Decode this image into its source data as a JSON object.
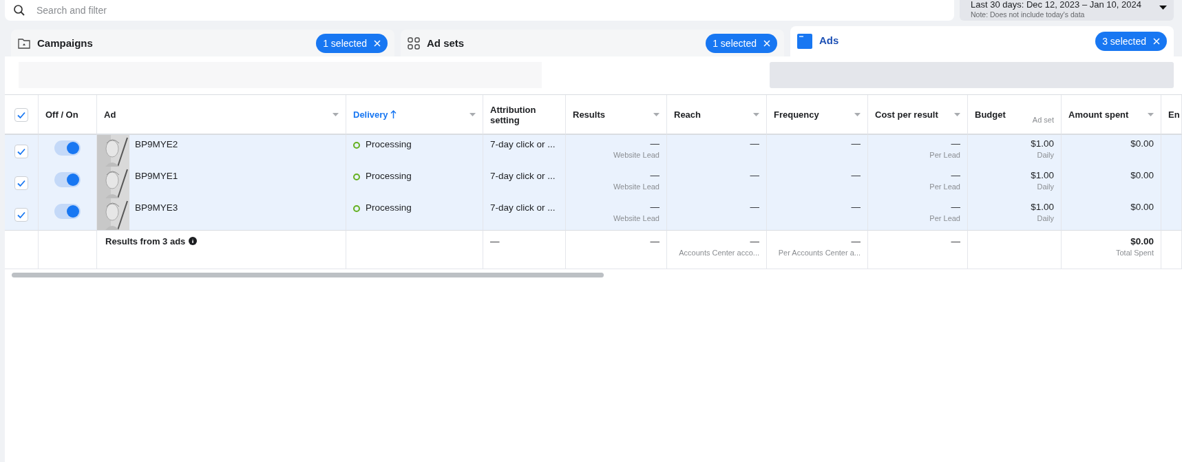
{
  "search": {
    "placeholder": "Search and filter"
  },
  "date_range": {
    "label": "Last 30 days: Dec 12, 2023 – Jan 10, 2024",
    "note": "Note: Does not include today's data"
  },
  "tabs": [
    {
      "kind": "folder",
      "label": "Campaigns",
      "badge": "1 selected",
      "selected": false
    },
    {
      "kind": "grid",
      "label": "Ad sets",
      "badge": "1 selected",
      "selected": false
    },
    {
      "kind": "ad",
      "label": "Ads",
      "badge": "3 selected",
      "selected": true
    }
  ],
  "table": {
    "all_selected": true,
    "columns": [
      {
        "label": "Off / On",
        "menu": false,
        "sorted": false
      },
      {
        "label": "Ad",
        "menu": true,
        "sorted": false
      },
      {
        "label": "Delivery",
        "menu": true,
        "sorted": true
      },
      {
        "label": "Attribution setting",
        "menu": false,
        "sorted": false
      },
      {
        "label": "Results",
        "menu": true,
        "sorted": false
      },
      {
        "label": "Reach",
        "menu": true,
        "sorted": false
      },
      {
        "label": "Frequency",
        "menu": true,
        "sorted": false
      },
      {
        "label": "Cost per result",
        "menu": true,
        "sorted": false
      },
      {
        "label": "Budget",
        "sublabel": "Ad set",
        "menu": false,
        "sorted": false
      },
      {
        "label": "Amount spent",
        "menu": true,
        "sorted": false
      },
      {
        "label": "En",
        "menu": false,
        "sorted": false
      }
    ],
    "rows": [
      {
        "selected": true,
        "on": true,
        "name": "BP9MYE2",
        "delivery": "Processing",
        "attribution": "7-day click or ...",
        "results": "—",
        "results_sub": "Website Lead",
        "reach": "—",
        "frequency": "—",
        "cost": "—",
        "cost_sub": "Per Lead",
        "budget": "$1.00",
        "budget_sub": "Daily",
        "amount": "$0.00"
      },
      {
        "selected": true,
        "on": true,
        "name": "BP9MYE1",
        "delivery": "Processing",
        "attribution": "7-day click or ...",
        "results": "—",
        "results_sub": "Website Lead",
        "reach": "—",
        "frequency": "—",
        "cost": "—",
        "cost_sub": "Per Lead",
        "budget": "$1.00",
        "budget_sub": "Daily",
        "amount": "$0.00"
      },
      {
        "selected": true,
        "on": true,
        "name": "BP9MYE3",
        "delivery": "Processing",
        "attribution": "7-day click or ...",
        "results": "—",
        "results_sub": "Website Lead",
        "reach": "—",
        "frequency": "—",
        "cost": "—",
        "cost_sub": "Per Lead",
        "budget": "$1.00",
        "budget_sub": "Daily",
        "amount": "$0.00"
      }
    ],
    "footer": {
      "label": "Results from 3 ads",
      "attribution": "—",
      "results": "—",
      "reach": "—",
      "reach_sub": "Accounts Center acco...",
      "frequency": "—",
      "frequency_sub": "Per Accounts Center a...",
      "cost": "—",
      "amount": "$0.00",
      "amount_sub": "Total Spent"
    }
  }
}
